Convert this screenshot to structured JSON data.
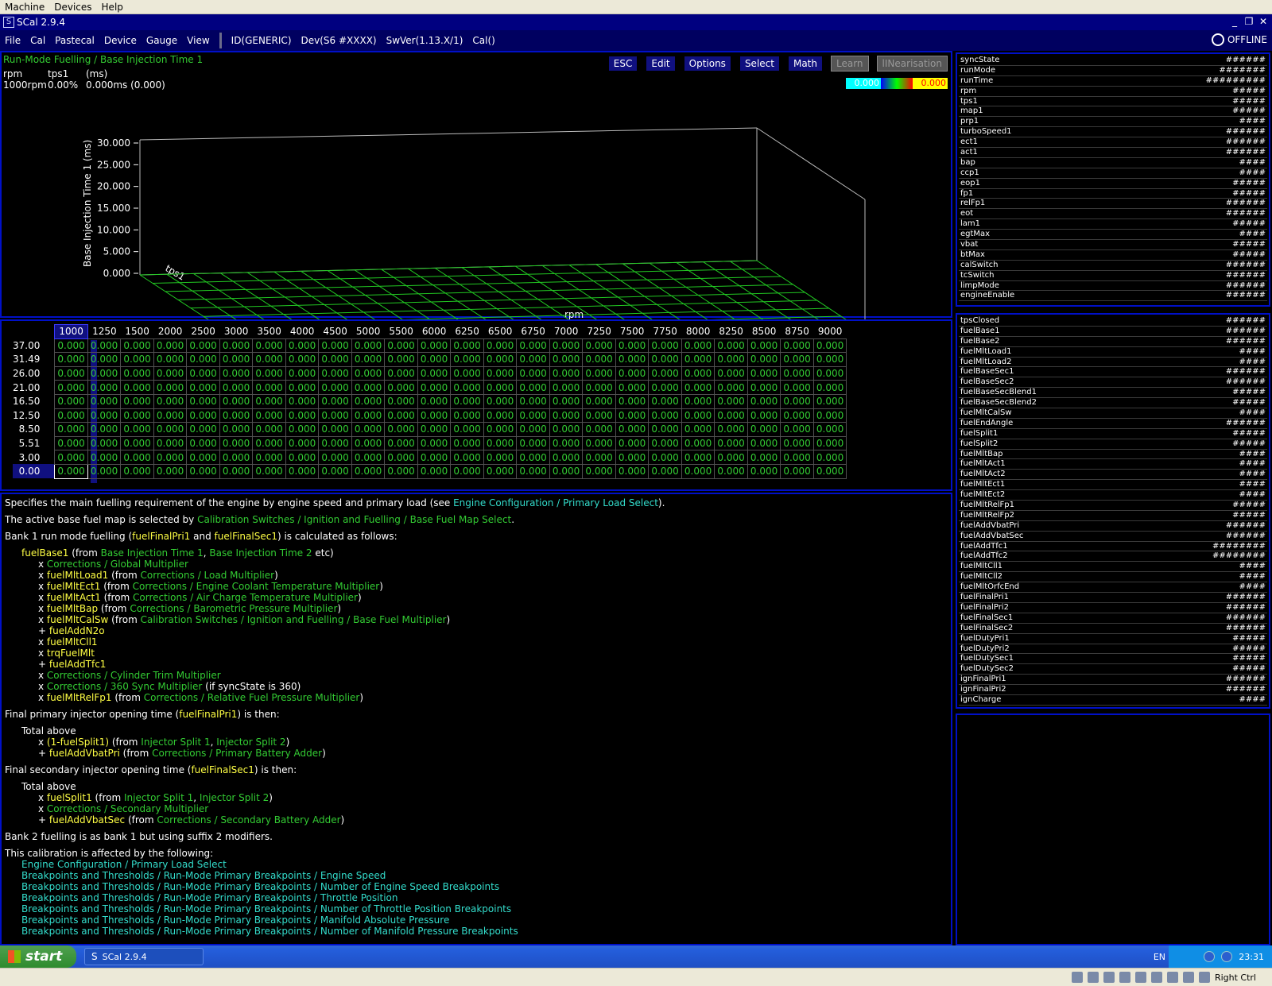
{
  "host_menu": [
    "Machine",
    "Devices",
    "Help"
  ],
  "window": {
    "title": "SCal 2.9.4"
  },
  "app_menu": [
    "File",
    "Cal",
    "Pastecal",
    "Device",
    "Gauge",
    "View"
  ],
  "device_info": {
    "id": "ID(GENERIC)",
    "dev": "Dev(S6 #XXXX)",
    "swver": "SwVer(1.13.X/1)",
    "cal": "Cal()"
  },
  "status": "OFFLINE",
  "graph": {
    "title": "Run-Mode Fuelling / Base Injection Time 1",
    "readout_headers": [
      "rpm",
      "tps1",
      "(ms)"
    ],
    "readout_values": [
      "1000rpm",
      "0.00%",
      "0.000ms (0.000)"
    ],
    "buttons": [
      "ESC",
      "Edit",
      "Options",
      "Select",
      "Math"
    ],
    "disabled_buttons": [
      "Learn",
      "lINearisation"
    ],
    "scale_min": "0.000",
    "scale_max": "0.000",
    "z_axis_label": "Base Injection Time 1 (ms)",
    "z_ticks": [
      "30.000",
      "25.000",
      "20.000",
      "15.000",
      "10.000",
      "5.000",
      "0.000"
    ],
    "x_axis_label": "rpm",
    "y_axis_label": "tps1"
  },
  "table": {
    "columns": [
      "1000",
      "1250",
      "1500",
      "2000",
      "2500",
      "3000",
      "3500",
      "4000",
      "4500",
      "5000",
      "5500",
      "6000",
      "6250",
      "6500",
      "6750",
      "7000",
      "7250",
      "7500",
      "7750",
      "8000",
      "8250",
      "8500",
      "8750",
      "9000"
    ],
    "rows": [
      "37.00",
      "31.49",
      "26.00",
      "21.00",
      "16.50",
      "12.50",
      "8.50",
      "5.51",
      "3.00",
      "0.00"
    ],
    "cell_value": "0.000"
  },
  "help": {
    "p1_a": "Specifies the main fuelling requirement of the engine by engine speed and primary load (see ",
    "p1_link": "Engine Configuration / Primary Load Select",
    "p1_b": ").",
    "p2_a": "The active base fuel map is selected by ",
    "p2_link": "Calibration Switches / Ignition and Fuelling / Base Fuel Map Select",
    "p2_b": ".",
    "p3_a": "Bank 1 run mode fuelling (",
    "p3_v1": "fuelFinalPri1",
    "p3_b": " and ",
    "p3_v2": "fuelFinalSec1",
    "p3_c": ") is calculated as follows:",
    "base_var": "fuelBase1",
    "base_a": " (from ",
    "base_l1": "Base Injection Time 1",
    "base_b": ", ",
    "base_l2": "Base Injection Time 2",
    "base_c": " etc)",
    "terms": [
      {
        "op": "x ",
        "var": "",
        "mid": "",
        "link": "Corrections / Global Multiplier",
        "end": ""
      },
      {
        "op": "x ",
        "var": "fuelMltLoad1",
        "mid": " (from ",
        "link": "Corrections / Load Multiplier",
        "end": ")"
      },
      {
        "op": "x ",
        "var": "fuelMltEct1",
        "mid": " (from ",
        "link": "Corrections / Engine Coolant Temperature Multiplier",
        "end": ")"
      },
      {
        "op": "x ",
        "var": "fuelMltAct1",
        "mid": " (from ",
        "link": "Corrections / Air Charge Temperature Multiplier",
        "end": ")"
      },
      {
        "op": "x ",
        "var": "fuelMltBap",
        "mid": " (from ",
        "link": "Corrections / Barometric Pressure Multiplier",
        "end": ")"
      },
      {
        "op": "x ",
        "var": "fuelMltCalSw",
        "mid": " (from ",
        "link": "Calibration Switches / Ignition and Fuelling / Base Fuel Multiplier",
        "end": ")"
      },
      {
        "op": "+ ",
        "var": "fuelAddN2o",
        "mid": "",
        "link": "",
        "end": ""
      },
      {
        "op": "x ",
        "var": "fuelMltCll1",
        "mid": "",
        "link": "",
        "end": ""
      },
      {
        "op": "x ",
        "var": "trqFuelMlt",
        "mid": "",
        "link": "",
        "end": ""
      },
      {
        "op": "+ ",
        "var": "fuelAddTfc1",
        "mid": "",
        "link": "",
        "end": ""
      },
      {
        "op": "x ",
        "var": "",
        "mid": "",
        "link": "Corrections / Cylinder Trim Multiplier",
        "end": ""
      },
      {
        "op": "x ",
        "var": "",
        "mid": "",
        "link": "Corrections / 360 Sync Multiplier",
        "end": " (if syncState is 360)"
      },
      {
        "op": "x ",
        "var": "fuelMltRelFp1",
        "mid": " (from ",
        "link": "Corrections / Relative Fuel Pressure Multiplier",
        "end": ")"
      }
    ],
    "p4_a": "Final primary injector opening time (",
    "p4_v": "fuelFinalPri1",
    "p4_b": ") is then:",
    "total_above": "Total above",
    "pri_terms": [
      {
        "op": "x ",
        "var": "(1-fuelSplit1)",
        "mid": " (from ",
        "link": "Injector Split 1",
        "sep": ", ",
        "link2": "Injector Split 2",
        "end": ")"
      },
      {
        "op": "+ ",
        "var": "fuelAddVbatPri",
        "mid": " (from ",
        "link": "Corrections / Primary Battery Adder",
        "sep": "",
        "link2": "",
        "end": ")"
      }
    ],
    "p5_a": "Final secondary injector opening time (",
    "p5_v": "fuelFinalSec1",
    "p5_b": ") is then:",
    "sec_terms": [
      {
        "op": "x ",
        "var": "fuelSplit1",
        "mid": " (from ",
        "link": "Injector Split 1",
        "sep": ", ",
        "link2": "Injector Split 2",
        "end": ")"
      },
      {
        "op": "x ",
        "var": "",
        "mid": "",
        "link": "Corrections / Secondary Multiplier",
        "sep": "",
        "link2": "",
        "end": ""
      },
      {
        "op": "+ ",
        "var": "fuelAddVbatSec",
        "mid": " (from ",
        "link": "Corrections / Secondary Battery Adder",
        "sep": "",
        "link2": "",
        "end": ")"
      }
    ],
    "p6": "Bank 2 fuelling is as bank 1 but using suffix 2 modifiers.",
    "p7": "This calibration is affected by the following:",
    "affected": [
      "Engine Configuration / Primary Load Select",
      "Breakpoints and Thresholds / Run-Mode Primary Breakpoints / Engine Speed",
      "Breakpoints and Thresholds / Run-Mode Primary Breakpoints / Number of Engine Speed Breakpoints",
      "Breakpoints and Thresholds / Run-Mode Primary Breakpoints / Throttle Position",
      "Breakpoints and Thresholds / Run-Mode Primary Breakpoints / Number of Throttle Position Breakpoints",
      "Breakpoints and Thresholds / Run-Mode Primary Breakpoints / Manifold Absolute Pressure",
      "Breakpoints and Thresholds / Run-Mode Primary Breakpoints / Number of Manifold Pressure Breakpoints"
    ]
  },
  "watch1": [
    [
      "syncState",
      "######"
    ],
    [
      "runMode",
      "#######"
    ],
    [
      "runTime",
      "#########"
    ],
    [
      "rpm",
      "#####"
    ],
    [
      "tps1",
      "#####"
    ],
    [
      "map1",
      "#####"
    ],
    [
      "prp1",
      "####"
    ],
    [
      "turboSpeed1",
      "######"
    ],
    [
      "ect1",
      "######"
    ],
    [
      "act1",
      "######"
    ],
    [
      "bap",
      "####"
    ],
    [
      "ccp1",
      "####"
    ],
    [
      "eop1",
      "#####"
    ],
    [
      "fp1",
      "#####"
    ],
    [
      "relFp1",
      "######"
    ],
    [
      "eot",
      "######"
    ],
    [
      "lam1",
      "#####"
    ],
    [
      "egtMax",
      "####"
    ],
    [
      "vbat",
      "#####"
    ],
    [
      "btMax",
      "#####"
    ],
    [
      "calSwitch",
      "######"
    ],
    [
      "tcSwitch",
      "######"
    ],
    [
      "limpMode",
      "######"
    ],
    [
      "engineEnable",
      "######"
    ]
  ],
  "watch2": [
    [
      "tpsClosed",
      "######"
    ],
    [
      "fuelBase1",
      "######"
    ],
    [
      "fuelBase2",
      "######"
    ],
    [
      "fuelMltLoad1",
      "####"
    ],
    [
      "fuelMltLoad2",
      "####"
    ],
    [
      "fuelBaseSec1",
      "######"
    ],
    [
      "fuelBaseSec2",
      "######"
    ],
    [
      "fuelBaseSecBlend1",
      "#####"
    ],
    [
      "fuelBaseSecBlend2",
      "#####"
    ],
    [
      "fuelMltCalSw",
      "####"
    ],
    [
      "fuelEndAngle",
      "######"
    ],
    [
      "fuelSplit1",
      "#####"
    ],
    [
      "fuelSplit2",
      "#####"
    ],
    [
      "fuelMltBap",
      "####"
    ],
    [
      "fuelMltAct1",
      "####"
    ],
    [
      "fuelMltAct2",
      "####"
    ],
    [
      "fuelMltEct1",
      "####"
    ],
    [
      "fuelMltEct2",
      "####"
    ],
    [
      "fuelMltRelFp1",
      "#####"
    ],
    [
      "fuelMltRelFp2",
      "#####"
    ],
    [
      "fuelAddVbatPri",
      "######"
    ],
    [
      "fuelAddVbatSec",
      "######"
    ],
    [
      "fuelAddTfc1",
      "########"
    ],
    [
      "fuelAddTfc2",
      "########"
    ],
    [
      "fuelMltCll1",
      "####"
    ],
    [
      "fuelMltCll2",
      "####"
    ],
    [
      "fuelMltOrfcEnd",
      "####"
    ],
    [
      "fuelFinalPri1",
      "######"
    ],
    [
      "fuelFinalPri2",
      "######"
    ],
    [
      "fuelFinalSec1",
      "######"
    ],
    [
      "fuelFinalSec2",
      "######"
    ],
    [
      "fuelDutyPri1",
      "#####"
    ],
    [
      "fuelDutyPri2",
      "#####"
    ],
    [
      "fuelDutySec1",
      "#####"
    ],
    [
      "fuelDutySec2",
      "#####"
    ],
    [
      "ignFinalPri1",
      "######"
    ],
    [
      "ignFinalPri2",
      "######"
    ],
    [
      "ignCharge",
      "####"
    ]
  ],
  "taskbar": {
    "start": "start",
    "task": "SCal 2.9.4",
    "lang": "EN",
    "clock": "23:31"
  },
  "host_status": {
    "key": "Right Ctrl"
  },
  "colors": {
    "accent_green": "#33cc33",
    "var_yellow": "#ffff44",
    "panel_border": "#0010c8"
  }
}
